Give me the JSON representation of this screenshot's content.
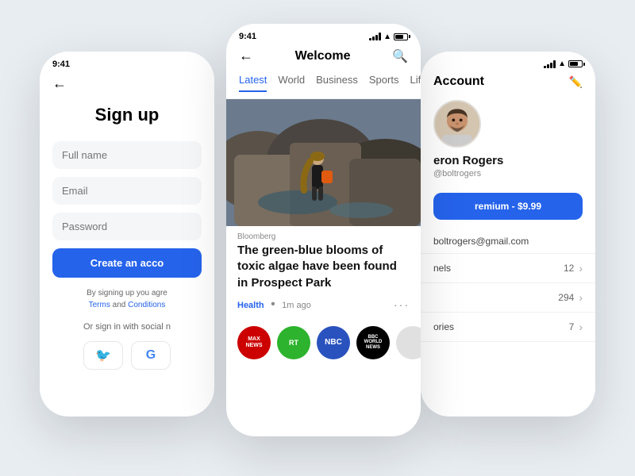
{
  "background": "#e8edf2",
  "phones": {
    "left": {
      "statusbar": {
        "time": "9:41"
      },
      "title": "Sign up",
      "fields": [
        {
          "placeholder": "Full name"
        },
        {
          "placeholder": "Email"
        },
        {
          "placeholder": "Password"
        }
      ],
      "createBtn": "Create an acco",
      "termsText": "By signing up you agre",
      "termsLink1": "Terms",
      "termsAnd": " and ",
      "termsLink2": "Conditions",
      "orDivider": "Or sign in with social n",
      "socialBtns": [
        "🐦",
        "G"
      ]
    },
    "middle": {
      "statusbar": {
        "time": "9:41"
      },
      "navTitle": "Welcome",
      "tabs": [
        {
          "label": "Latest",
          "active": true
        },
        {
          "label": "World"
        },
        {
          "label": "Business"
        },
        {
          "label": "Sports"
        },
        {
          "label": "Life"
        }
      ],
      "article": {
        "source": "Bloomberg",
        "headline": "The green-blue blooms of toxic algae have been found in Prospect Park",
        "tag": "Health",
        "time": "1m ago"
      },
      "channels": [
        {
          "name": "Max News",
          "class": "ch-max",
          "text": "MAX\nNEWS"
        },
        {
          "name": "RT",
          "class": "ch-rt",
          "text": "RT"
        },
        {
          "name": "NBC",
          "class": "ch-nbc",
          "text": "NBC"
        },
        {
          "name": "BBC World News",
          "class": "ch-bbc",
          "text": "BBC\nWORLD\nNEWS"
        }
      ]
    },
    "right": {
      "statusbar": {
        "time": ""
      },
      "title": "Account",
      "user": {
        "name": "eron Rogers",
        "handle": "@boltrogers",
        "email": "boltrogers@gmail.com"
      },
      "premiumBtn": "remium - $9.99",
      "rows": [
        {
          "label": "nels",
          "count": "12"
        },
        {
          "label": "",
          "count": "294"
        },
        {
          "label": "ories",
          "count": "7"
        }
      ]
    }
  }
}
